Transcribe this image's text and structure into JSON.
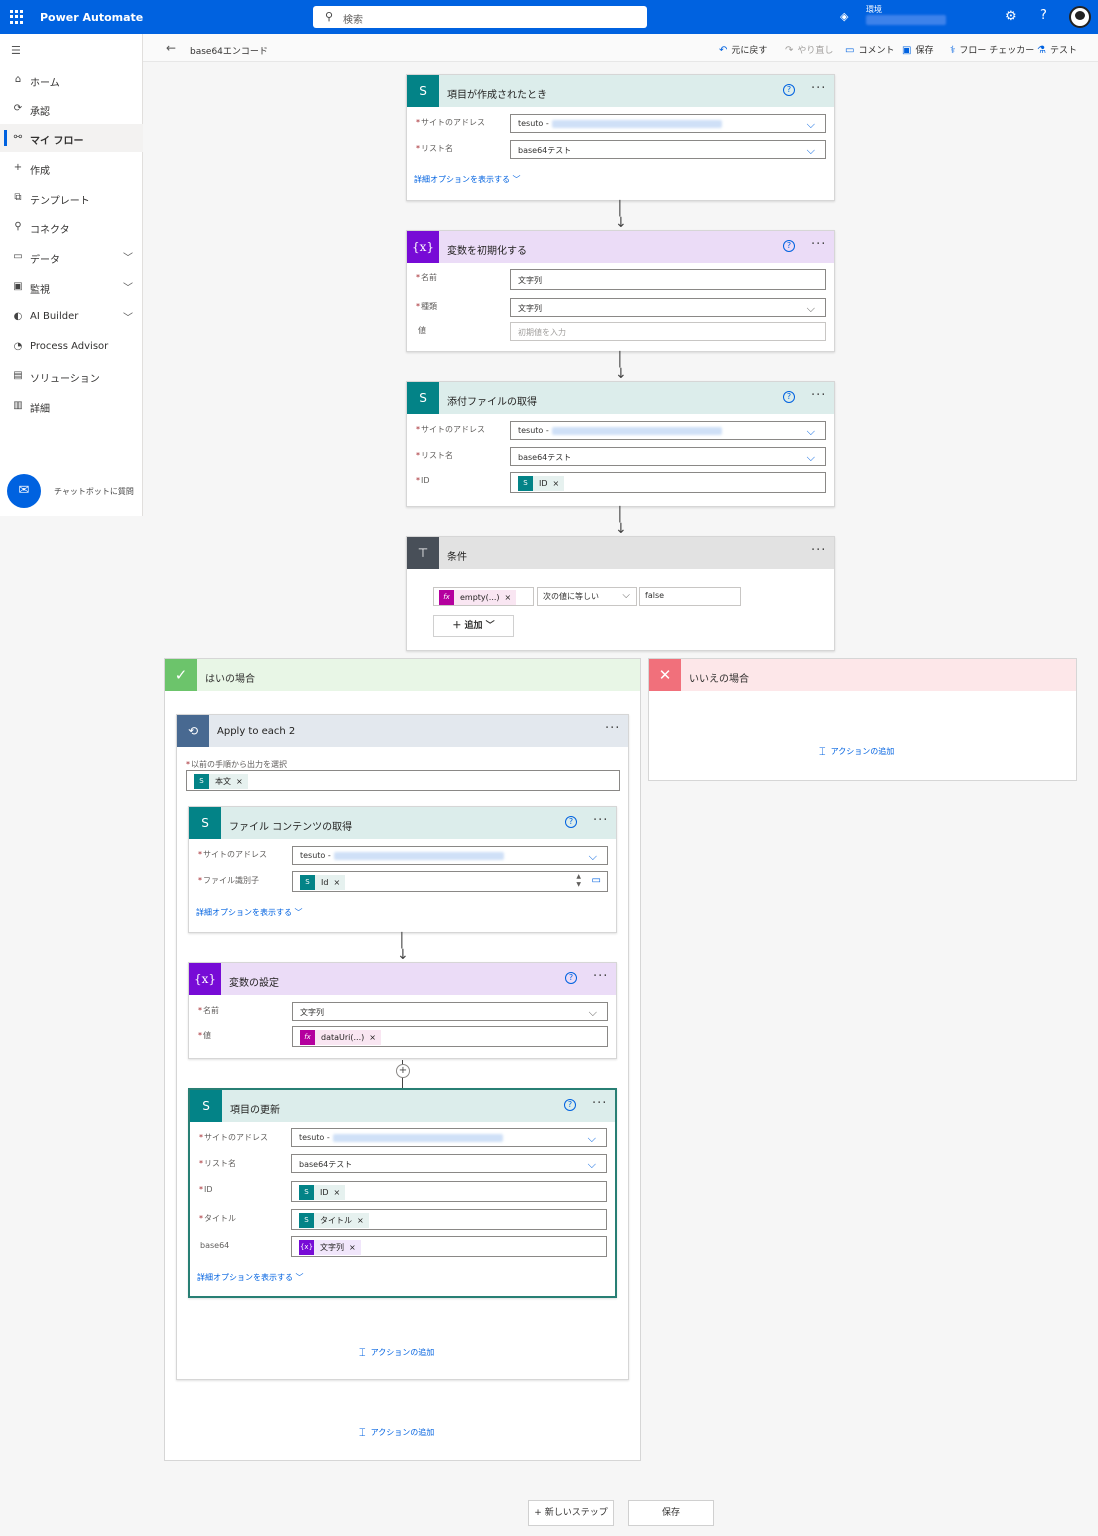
{
  "app": {
    "title": "Power Automate",
    "search_placeholder": "検索",
    "env_label": "環境"
  },
  "icons": {
    "waffle": "waffle-icon",
    "search": "search-icon",
    "settings": "gear-icon",
    "help": "help-icon"
  },
  "nav": {
    "items": [
      {
        "id": "home",
        "icon": "⌂",
        "label": "ホーム"
      },
      {
        "id": "approvals",
        "icon": "⟳",
        "label": "承認"
      },
      {
        "id": "myflows",
        "icon": "⚯",
        "label": "マイ フロー",
        "active": true
      },
      {
        "id": "create",
        "icon": "+",
        "label": "作成"
      },
      {
        "id": "templates",
        "icon": "⧉",
        "label": "テンプレート"
      },
      {
        "id": "connectors",
        "icon": "⚲",
        "label": "コネクタ"
      },
      {
        "id": "data",
        "icon": "▭",
        "label": "データ",
        "chevron": true
      },
      {
        "id": "monitor",
        "icon": "▣",
        "label": "監視",
        "chevron": true
      },
      {
        "id": "aibuilder",
        "icon": "◐",
        "label": "AI Builder",
        "chevron": true
      },
      {
        "id": "processadvisor",
        "icon": "◔",
        "label": "Process Advisor"
      },
      {
        "id": "solutions",
        "icon": "▤",
        "label": "ソリューション"
      },
      {
        "id": "learn",
        "icon": "▥",
        "label": "詳細"
      }
    ],
    "chatbot_label": "チャットボットに質問"
  },
  "command": {
    "flow_name": "base64エンコード",
    "undo": "元に戻す",
    "redo": "やり直し",
    "comment": "コメント",
    "save": "保存",
    "checker": "フロー チェッカー",
    "test": "テスト"
  },
  "trigger": {
    "title": "項目が作成されたとき",
    "site_label": "サイトのアドレス",
    "site_value": "tesuto -",
    "list_label": "リスト名",
    "list_value": "base64テスト",
    "advanced": "詳細オプションを表示する"
  },
  "initvar": {
    "title": "変数を初期化する",
    "name_label": "名前",
    "name_value": "文字列",
    "type_label": "種類",
    "type_value": "文字列",
    "value_label": "値",
    "value_placeholder": "初期値を入力"
  },
  "getattach": {
    "title": "添付ファイルの取得",
    "site_label": "サイトのアドレス",
    "site_value": "tesuto -",
    "list_label": "リスト名",
    "list_value": "base64テスト",
    "id_label": "ID",
    "id_token": "ID"
  },
  "condition": {
    "title": "条件",
    "left_token": "empty(...)",
    "operator": "次の値に等しい",
    "right_value": "false",
    "add_label": "追加"
  },
  "yes": {
    "title": "はいの場合",
    "add_action": "アクションの追加"
  },
  "no": {
    "title": "いいえの場合",
    "add_action": "アクションの追加"
  },
  "loop": {
    "title": "Apply to each 2",
    "select_label": "以前の手順から出力を選択",
    "select_token": "本文",
    "add_action": "アクションの追加"
  },
  "getfile": {
    "title": "ファイル コンテンツの取得",
    "site_label": "サイトのアドレス",
    "site_value": "tesuto -",
    "fileid_label": "ファイル識別子",
    "fileid_token": "Id",
    "advanced": "詳細オプションを表示する"
  },
  "setvar": {
    "title": "変数の設定",
    "name_label": "名前",
    "name_value": "文字列",
    "value_label": "値",
    "value_token": "dataUri(...)"
  },
  "update": {
    "title": "項目の更新",
    "site_label": "サイトのアドレス",
    "site_value": "tesuto -",
    "list_label": "リスト名",
    "list_value": "base64テスト",
    "id_label": "ID",
    "id_token": "ID",
    "title_label": "タイトル",
    "title_token": "タイトル",
    "b64_label": "base64",
    "b64_token": "文字列",
    "advanced": "詳細オプションを表示する"
  },
  "footer": {
    "new_step": "+ 新しいステップ",
    "save": "保存"
  }
}
